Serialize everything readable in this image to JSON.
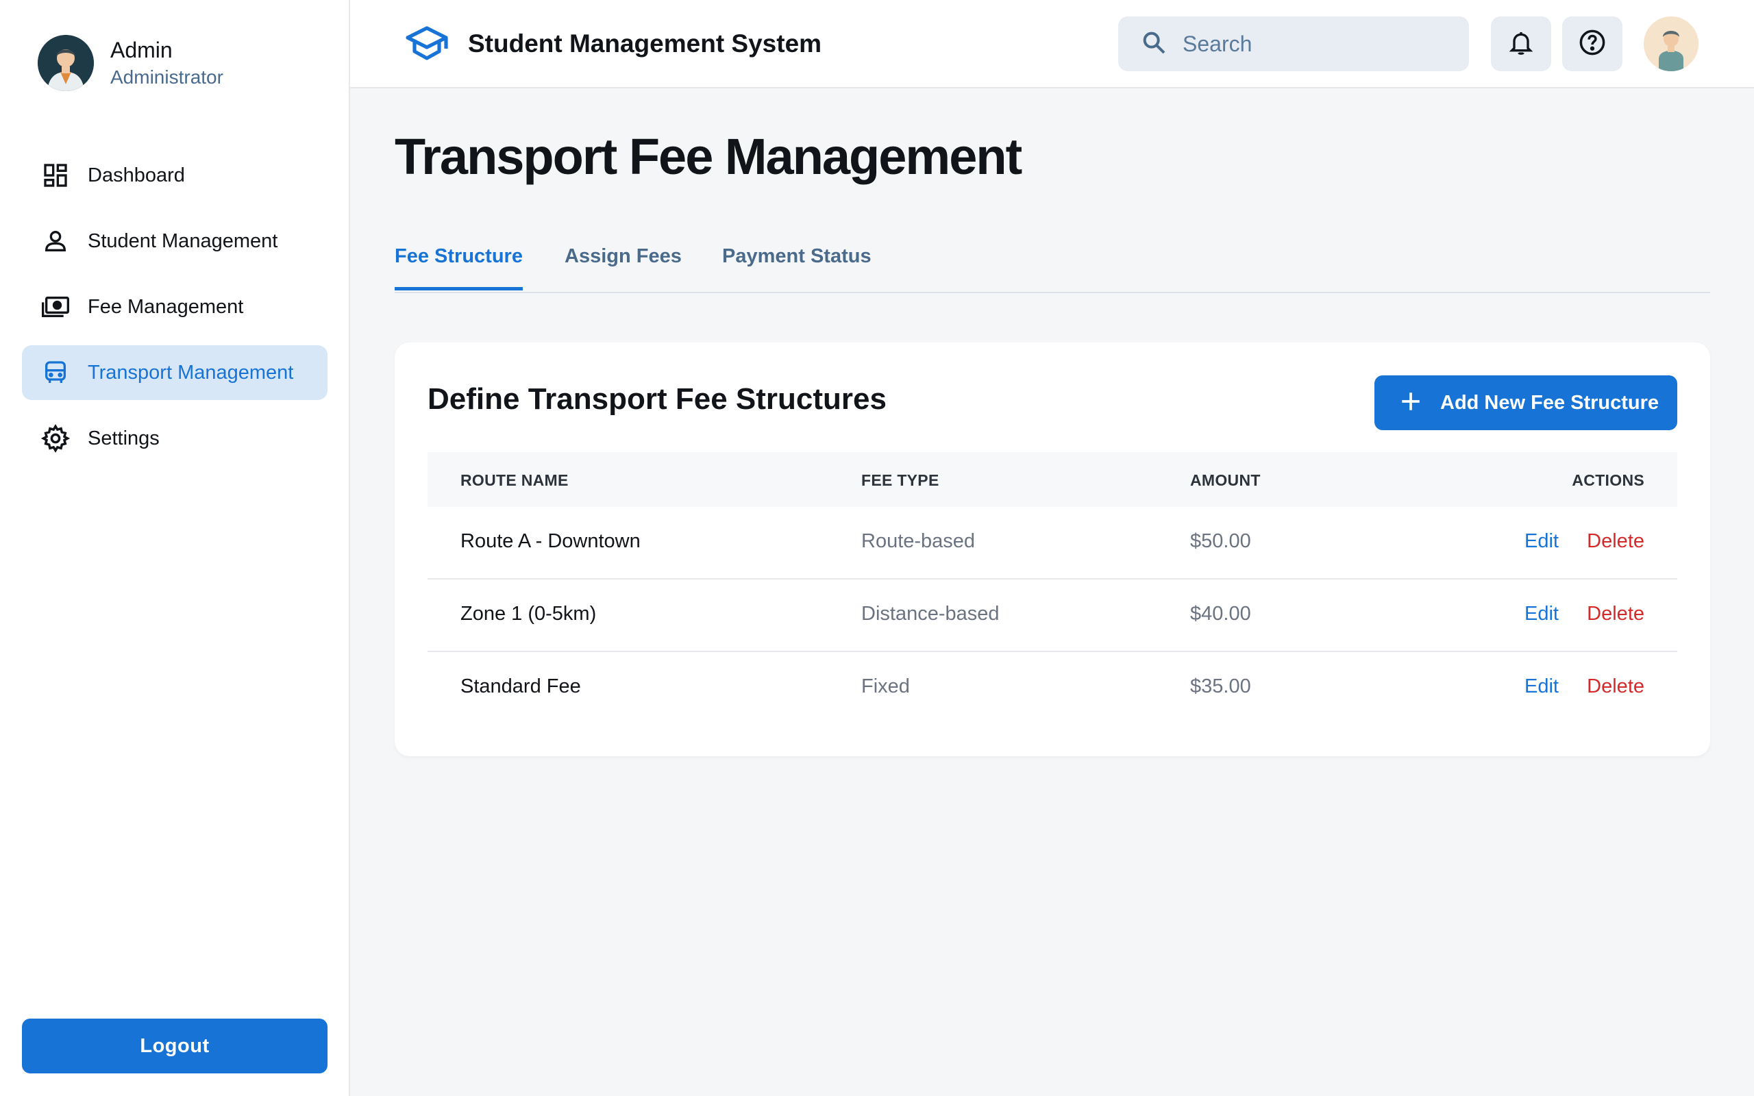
{
  "sidebar": {
    "user_name": "Admin",
    "user_role": "Administrator",
    "items": [
      {
        "label": "Dashboard",
        "icon": "dashboard-icon"
      },
      {
        "label": "Student Management",
        "icon": "person-icon"
      },
      {
        "label": "Fee Management",
        "icon": "payments-icon"
      },
      {
        "label": "Transport Management",
        "icon": "bus-icon",
        "active": true
      },
      {
        "label": "Settings",
        "icon": "gear-icon"
      }
    ],
    "logout_label": "Logout"
  },
  "header": {
    "app_title": "Student Management System",
    "search_placeholder": "Search"
  },
  "main": {
    "page_title": "Transport Fee Management",
    "tabs": [
      {
        "label": "Fee Structure",
        "active": true
      },
      {
        "label": "Assign Fees"
      },
      {
        "label": "Payment Status"
      }
    ],
    "card": {
      "title": "Define Transport Fee Structures",
      "add_button_label": "Add New Fee Structure",
      "columns": [
        "ROUTE NAME",
        "FEE TYPE",
        "AMOUNT",
        "ACTIONS"
      ],
      "rows": [
        {
          "route": "Route A - Downtown",
          "fee_type": "Route-based",
          "amount": "$50.00",
          "edit": "Edit",
          "delete": "Delete"
        },
        {
          "route": "Zone 1 (0-5km)",
          "fee_type": "Distance-based",
          "amount": "$40.00",
          "edit": "Edit",
          "delete": "Delete"
        },
        {
          "route": "Standard Fee",
          "fee_type": "Fixed",
          "amount": "$35.00",
          "edit": "Edit",
          "delete": "Delete"
        }
      ]
    }
  },
  "colors": {
    "accent": "#1773d5",
    "active_nav_bg": "#d7e7f7",
    "danger": "#d42a2a",
    "muted_text": "#6b7280",
    "page_bg": "#f5f6f8"
  }
}
